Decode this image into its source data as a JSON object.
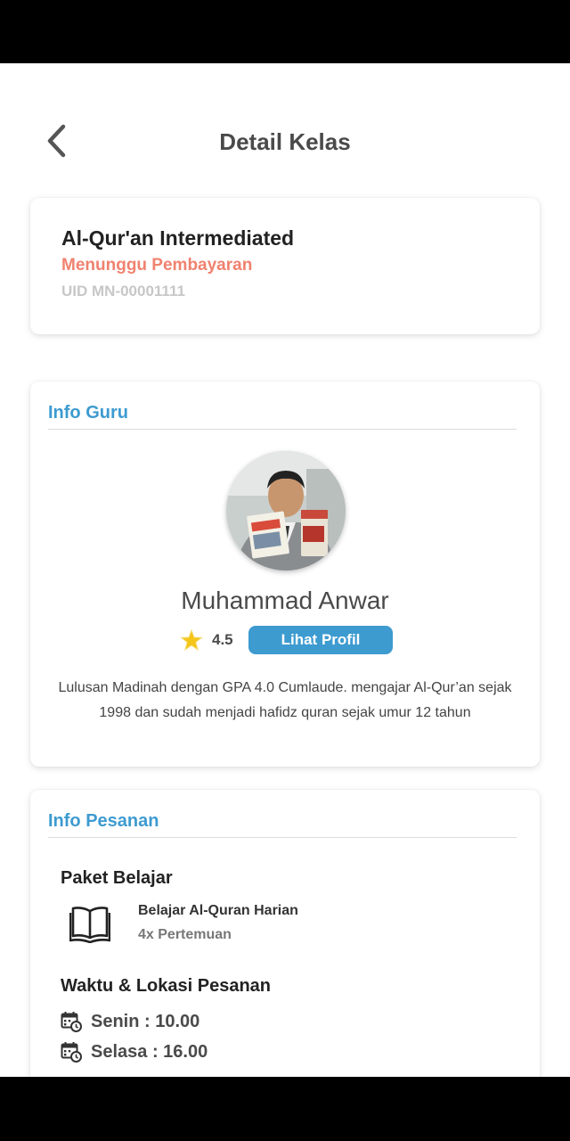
{
  "header": {
    "title": "Detail Kelas"
  },
  "class_card": {
    "name": "Al-Qur'an Intermediated",
    "status": "Menunggu Pembayaran",
    "uid": "UID MN-00001111"
  },
  "guru_card": {
    "section_title": "Info Guru",
    "teacher_name": "Muhammad Anwar",
    "rating": "4.5",
    "profile_button": "Lihat Profil",
    "bio": "Lulusan Madinah dengan GPA 4.0 Cumlaude. mengajar Al-Qur’an sejak 1998 dan sudah menjadi hafidz quran sejak umur 12 tahun"
  },
  "order_card": {
    "section_title": "Info Pesanan",
    "package_label": "Paket Belajar",
    "package_name": "Belajar Al-Quran Harian",
    "package_count": "4x Pertemuan",
    "schedule_label": "Waktu & Lokasi Pesanan",
    "schedules": [
      {
        "text": "Senin : 10.00"
      },
      {
        "text": "Selasa : 16.00"
      }
    ]
  },
  "colors": {
    "accent": "#3d9bd0",
    "status": "#f0826f",
    "uid": "#c7c7c7",
    "star": "#f5c518"
  },
  "icons": {
    "back": "chevron-left-icon",
    "star": "star-icon",
    "package": "book-icon",
    "schedule": "calendar-clock-icon"
  }
}
